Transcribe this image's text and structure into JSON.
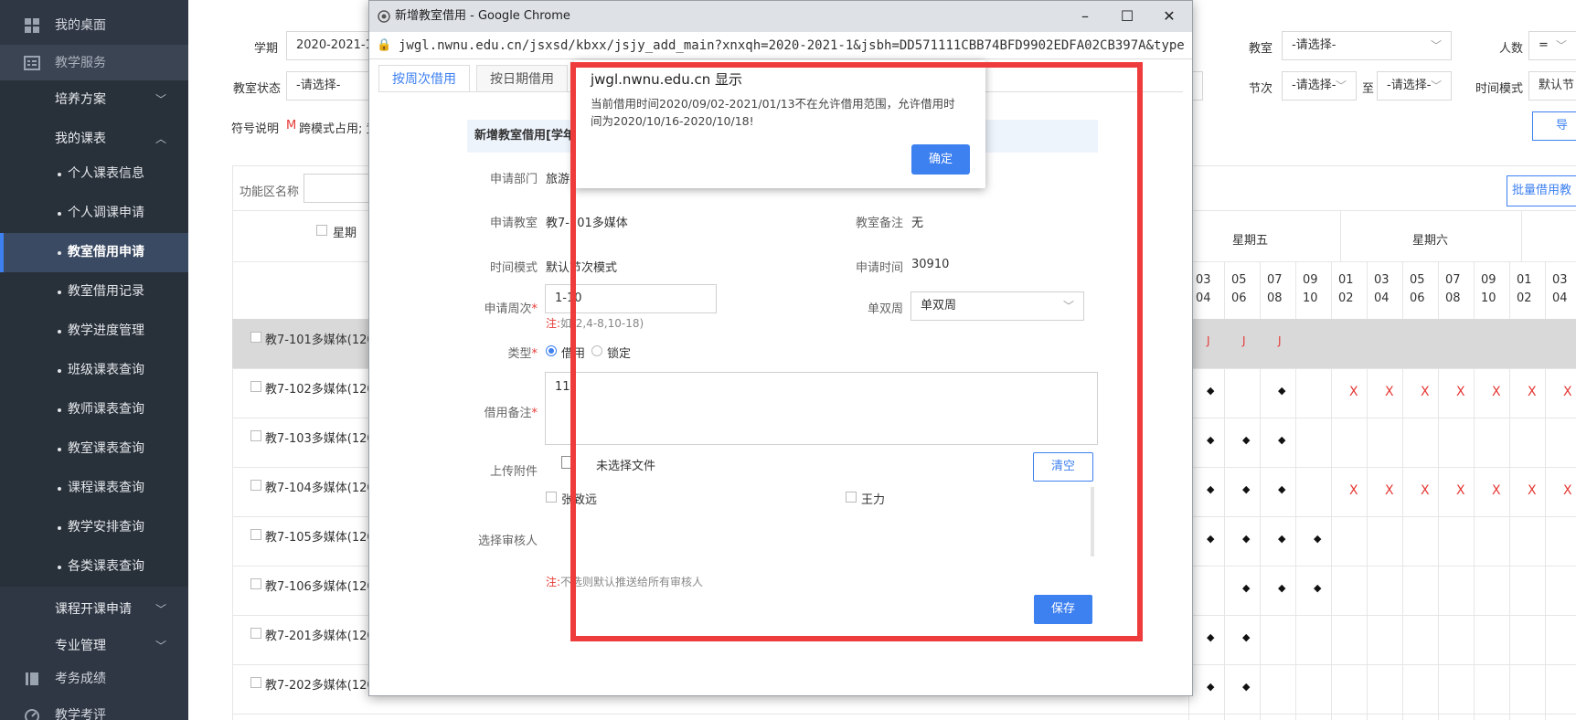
{
  "sidebar": {
    "desktop": "我的桌面",
    "teaching_service": "教学服务",
    "training_plan": "培养方案",
    "my_schedule": "我的课表",
    "leaf_items": [
      "个人课表信息",
      "个人调课申请",
      "教室借用申请",
      "教室借用记录",
      "教学进度管理",
      "班级课表查询",
      "教师课表查询",
      "教室课表查询",
      "课程课表查询",
      "教学安排查询",
      "各类课表查询"
    ],
    "course_apply": "课程开课申请",
    "major_mgmt": "专业管理",
    "exam_scores": "考务成绩",
    "teaching_eval": "教学考评"
  },
  "filters": {
    "term_label": "学期",
    "term_value": "2020-2021-1",
    "classroom_label": "教室",
    "classroom_value": "-请选择-",
    "people_label": "人数",
    "people_value": "=",
    "status_label": "教室状态",
    "status_value": "-请选择-",
    "section_label": "节次",
    "section_from": "-请选择-",
    "section_to_label": "至",
    "section_to": "-请选择-",
    "time_mode_label": "时间模式",
    "time_mode_value": "默认节",
    "legend_label": "符号说明",
    "legend_m": "M",
    "legend_m_text": "跨模式占用; 竞",
    "export_btn": "导",
    "area_label": "功能区名称",
    "batch_btn": "批量借用教"
  },
  "grid": {
    "col_week": "星期",
    "day5": "星期五",
    "day6": "星期六",
    "periods_top": [
      "03",
      "05",
      "07",
      "09",
      "01",
      "03",
      "05",
      "07",
      "09",
      "01",
      "03"
    ],
    "periods_bottom": [
      "04",
      "06",
      "08",
      "10",
      "02",
      "04",
      "06",
      "08",
      "10",
      "02",
      "04"
    ],
    "rooms": [
      "教7-101多媒体(120/0",
      "教7-102多媒体(120/0",
      "教7-103多媒体(120/0",
      "教7-104多媒体(120/0",
      "教7-105多媒体(120/0",
      "教7-106多媒体(120/0",
      "教7-201多媒体(120/0",
      "教7-202多媒体(120/0"
    ],
    "mark_j": "J",
    "mark_x": "X",
    "mark_dot": "◆"
  },
  "popup": {
    "window_title": "新增教室借用 - Google Chrome",
    "url": "jwgl.nwnu.edu.cn/jsxsd/kbxx/jsjy_add_main?xnxqh=2020-2021-1&jsbh=DD571111CBB74BFD9902EDFA02CB397A&typewhe...",
    "tab_week": "按周次借用",
    "tab_date": "按日期借用",
    "section_title": "新增教室借用[学年学",
    "dept_label": "申请部门",
    "dept_value": "旅游学",
    "room_label": "申请教室",
    "room_value": "教7-101多媒体",
    "room_note_label": "教室备注",
    "room_note_value": "无",
    "time_mode_label": "时间模式",
    "time_mode_value": "默认节次模式",
    "apply_time_label": "申请时间",
    "apply_time_value": "30910",
    "weeks_label": "申请周次",
    "weeks_value": "1-10",
    "weeks_note_prefix": "注:",
    "weeks_note": "如(2,4-8,10-18)",
    "oddeven_label": "单双周",
    "oddeven_value": "单双周",
    "type_label": "类型",
    "type_borrow": "借用",
    "type_lock": "锁定",
    "remark_label": "借用备注",
    "remark_value": "11",
    "attach_label": "上传附件",
    "attach_file_text": "未选择文件",
    "clear_btn": "清空",
    "approver1": "张致远",
    "approver2": "王力",
    "approver_label": "选择审核人",
    "approver_note_prefix": "注:",
    "approver_note": "不选则默认推送给所有审核人",
    "save_btn": "保存"
  },
  "alert": {
    "title": "jwgl.nwnu.edu.cn 显示",
    "message": "当前借用时间2020/09/02-2021/01/13不在允许借用范围，允许借用时间为2020/10/16-2020/10/18!",
    "ok": "确定"
  },
  "colors": {
    "sidebar_bg": "#2f3744",
    "accent": "#3d80f0",
    "highlight": "#ee3b3b"
  }
}
